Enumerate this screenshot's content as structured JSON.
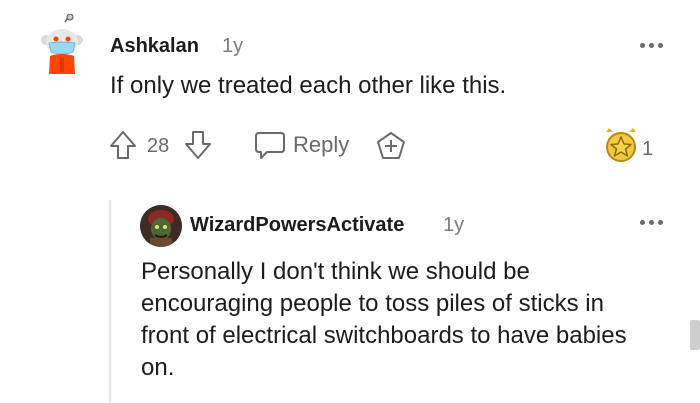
{
  "comment": {
    "username": "Ashkalan",
    "age": "1y",
    "text": "If only we treated each other like this.",
    "vote_count": "28",
    "reply_label": "Reply",
    "award_count": "1"
  },
  "reply": {
    "username": "WizardPowersActivate",
    "age": "1y",
    "text": "Personally I don't think we should be encouraging people to toss piles of sticks in front of electrical switchboards to have babies on."
  },
  "icons": {
    "upvote": "upvote-arrow-icon",
    "downvote": "downvote-arrow-icon",
    "reply": "speech-bubble-icon",
    "give_award": "add-award-icon",
    "award": "gold-star-award-icon",
    "more": "more-options-icon"
  },
  "colors": {
    "text": "#1c1c1c",
    "muted": "#7c7c7c",
    "icon": "#6a6a6a",
    "award_gold": "#f5c842",
    "thread_line": "#e4e4e4"
  }
}
